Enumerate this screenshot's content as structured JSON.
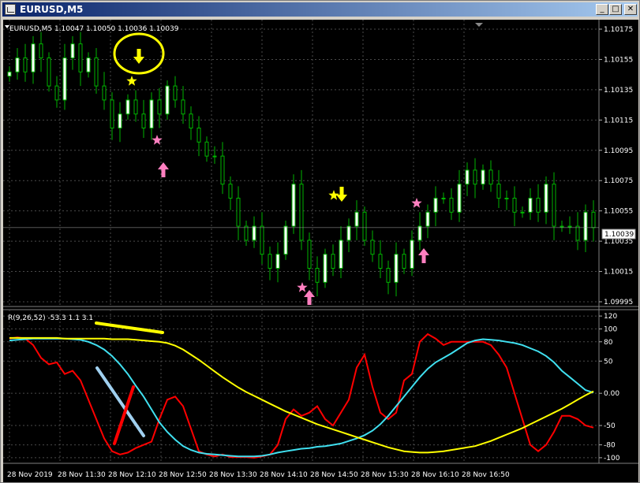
{
  "window": {
    "title": "EURUSD,M5",
    "minimize_glyph": "_",
    "maximize_glyph": "□",
    "close_glyph": "✕"
  },
  "chart_header": "EURUSD,M5  1.10047 1.10050 1.10036 1.10039",
  "current_price_label": "1.10039",
  "indicator_label": "R(9,26,52) -53.3 1.1 3.1",
  "colors": {
    "background": "#000000",
    "grid": "#4a4a4a",
    "text": "#ffffff",
    "candle": "#00b400",
    "bull_body": "#ffffff",
    "bear_body": "#000000",
    "red": "#ff0000",
    "cyan": "#40e0f0",
    "yellow": "#ffff00",
    "pink": "#ff7fc0",
    "star_yellow": "#ffff00",
    "drawing_blue": "#a0d0f0",
    "circle": "#ffff00"
  },
  "chart_data": [
    {
      "type": "candlestick",
      "symbol": "EURUSD",
      "timeframe": "M5",
      "ylim": [
        1.09985,
        1.10185
      ],
      "yticks": [
        "1.10175",
        "1.10155",
        "1.10135",
        "1.10115",
        "1.10095",
        "1.10075",
        "1.10055",
        "1.10035",
        "1.10015",
        "1.09995"
      ],
      "xticks": [
        "28 Nov 2019",
        "28 Nov 11:30",
        "28 Nov 12:10",
        "28 Nov 12:50",
        "28 Nov 13:30",
        "28 Nov 14:10",
        "28 Nov 14:50",
        "28 Nov 15:30",
        "28 Nov 16:10",
        "28 Nov 16:50"
      ],
      "num_bars": 75,
      "closes": [
        1.1015,
        1.1016,
        1.1015,
        1.1017,
        1.1016,
        1.1014,
        1.1013,
        1.1016,
        1.1017,
        1.1015,
        1.1016,
        1.1014,
        1.1013,
        1.1011,
        1.1012,
        1.1013,
        1.1012,
        1.1011,
        1.1013,
        1.1012,
        1.1014,
        1.1013,
        1.1012,
        1.1011,
        1.101,
        1.1009,
        1.1009,
        1.1007,
        1.1006,
        1.1004,
        1.1003,
        1.1004,
        1.1002,
        1.1001,
        1.1002,
        1.1004,
        1.1007,
        1.1003,
        1.1001,
        1.1,
        1.1002,
        1.1001,
        1.1003,
        1.1004,
        1.1005,
        1.1003,
        1.1002,
        1.1001,
        1.1,
        1.1002,
        1.1001,
        1.1003,
        1.1004,
        1.1005,
        1.1006,
        1.1006,
        1.1005,
        1.1007,
        1.1008,
        1.1007,
        1.1008,
        1.1007,
        1.1006,
        1.1006,
        1.1005,
        1.1005,
        1.1006,
        1.1005,
        1.1007,
        1.1004,
        1.1004,
        1.1004,
        1.1003,
        1.1005,
        1.10039
      ]
    },
    {
      "type": "line",
      "title": "R(9,26,52) -53.3 1.1 3.1",
      "ylim": [
        -105,
        125
      ],
      "yticks": [
        "120",
        "100",
        "80",
        "50",
        "0.00",
        "-50",
        "-80",
        "-100"
      ],
      "series": [
        {
          "color": "red",
          "y": [
            85,
            87,
            85,
            75,
            55,
            45,
            48,
            30,
            35,
            20,
            -10,
            -40,
            -70,
            -90,
            -95,
            -92,
            -85,
            -80,
            -75,
            -40,
            -10,
            -5,
            -20,
            -55,
            -90,
            -95,
            -98,
            -95,
            -99,
            -99,
            -99,
            -100,
            -98,
            -95,
            -80,
            -40,
            -25,
            -35,
            -30,
            -20,
            -40,
            -50,
            -30,
            -10,
            40,
            60,
            10,
            -30,
            -40,
            -30,
            20,
            30,
            80,
            92,
            85,
            75,
            80,
            80,
            80,
            80,
            80,
            75,
            60,
            40,
            0,
            -40,
            -80,
            -90,
            -80,
            -60,
            -35,
            -35,
            -40,
            -50,
            -53.3
          ]
        },
        {
          "color": "cyan",
          "y": [
            82,
            83,
            84,
            85,
            85,
            85,
            85,
            85,
            84,
            83,
            80,
            75,
            68,
            58,
            45,
            30,
            12,
            -5,
            -25,
            -45,
            -60,
            -72,
            -82,
            -88,
            -92,
            -94,
            -95,
            -96,
            -97,
            -98,
            -98,
            -98,
            -97,
            -95,
            -92,
            -90,
            -88,
            -86,
            -85,
            -83,
            -82,
            -80,
            -78,
            -74,
            -70,
            -65,
            -58,
            -48,
            -35,
            -20,
            -5,
            10,
            25,
            38,
            48,
            55,
            62,
            70,
            78,
            82,
            84,
            83,
            82,
            80,
            78,
            75,
            70,
            65,
            58,
            48,
            35,
            25,
            15,
            5,
            1.1
          ]
        },
        {
          "color": "yellow",
          "y": [
            86,
            86,
            86,
            86,
            86,
            86,
            86,
            85,
            85,
            85,
            85,
            85,
            85,
            84,
            84,
            84,
            83,
            82,
            81,
            80,
            78,
            74,
            68,
            60,
            52,
            43,
            34,
            25,
            17,
            9,
            2,
            -4,
            -10,
            -16,
            -22,
            -28,
            -33,
            -38,
            -43,
            -48,
            -52,
            -56,
            -60,
            -64,
            -68,
            -72,
            -76,
            -80,
            -84,
            -87,
            -90,
            -91,
            -92,
            -92,
            -91,
            -90,
            -88,
            -86,
            -84,
            -82,
            -78,
            -74,
            -69,
            -64,
            -59,
            -54,
            -48,
            -42,
            -36,
            -30,
            -24,
            -17,
            -10,
            -3,
            3.1
          ]
        }
      ]
    }
  ]
}
